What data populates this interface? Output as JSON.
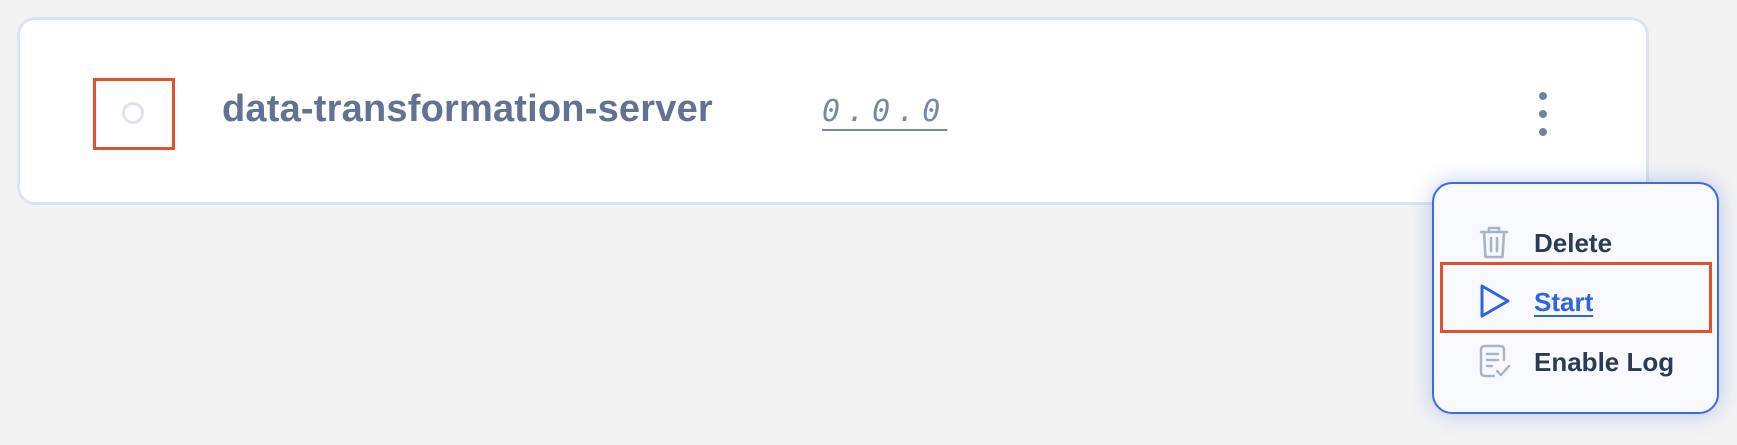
{
  "server": {
    "name": "data-transformation-server",
    "version": "0.0.0"
  },
  "menu": {
    "items": [
      {
        "label": "Delete",
        "icon": "trash-icon"
      },
      {
        "label": "Start",
        "icon": "play-icon"
      },
      {
        "label": "Enable Log",
        "icon": "log-icon"
      }
    ]
  },
  "colors": {
    "highlight": "#e0512f",
    "accent": "#2f63e0",
    "card_border": "#dde3ef",
    "name_text": "#637192",
    "menu_border": "#3d6be0"
  }
}
